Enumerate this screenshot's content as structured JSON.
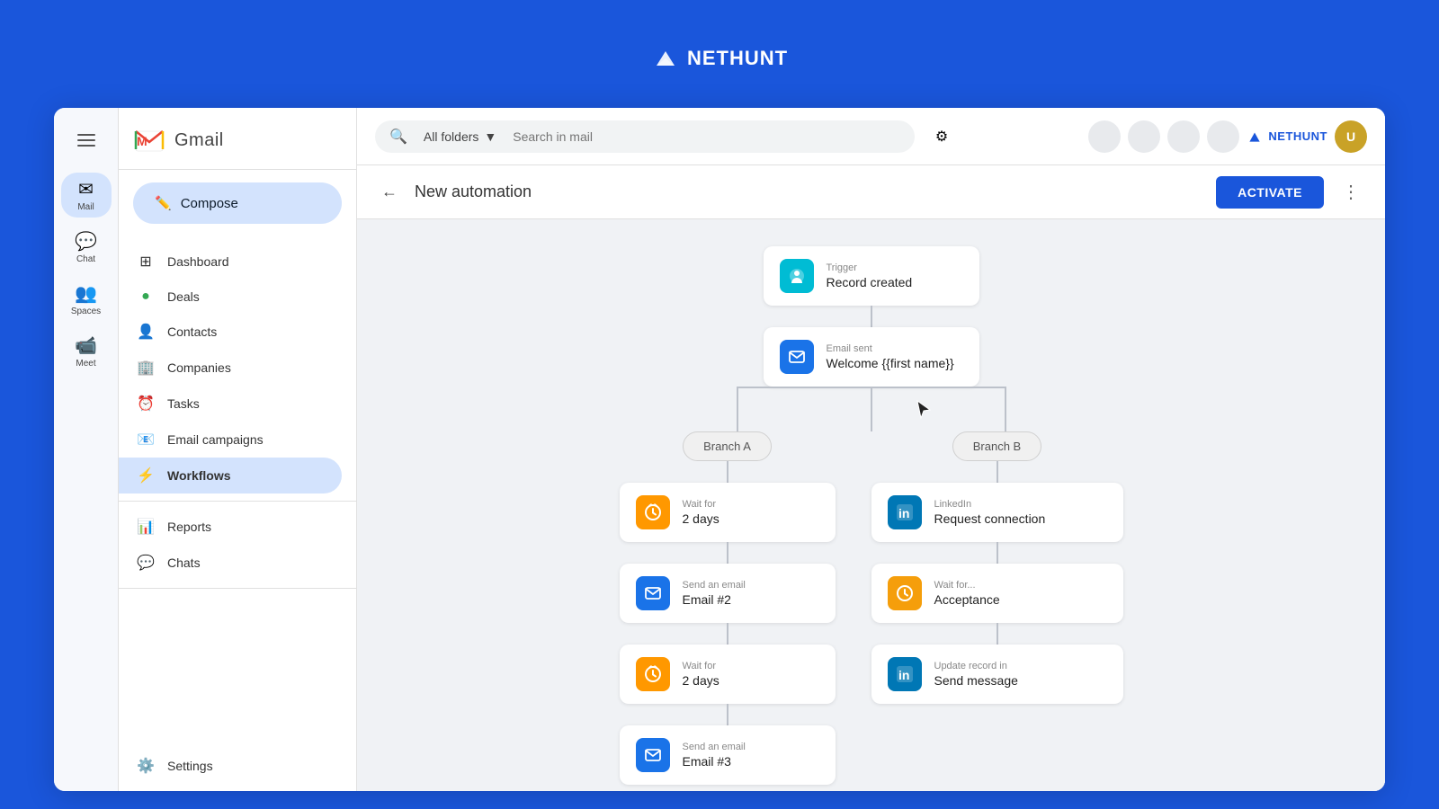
{
  "app": {
    "name": "NetHunt",
    "logo_text": "NETHUNT",
    "gmail_title": "Gmail"
  },
  "topbar": {
    "search_placeholder": "Search in mail",
    "folder_label": "All folders"
  },
  "gmail_sidebar": {
    "items": [
      {
        "id": "mail",
        "label": "Mail",
        "icon": "✉",
        "active": true
      },
      {
        "id": "chat",
        "label": "Chat",
        "icon": "💬",
        "active": false
      },
      {
        "id": "spaces",
        "label": "Spaces",
        "icon": "👥",
        "active": false
      },
      {
        "id": "meet",
        "label": "Meet",
        "icon": "📹",
        "active": false
      }
    ]
  },
  "nethunt_sidebar": {
    "compose_label": "Compose",
    "nav_items": [
      {
        "id": "dashboard",
        "label": "Dashboard",
        "icon": "⊞",
        "active": false
      },
      {
        "id": "deals",
        "label": "Deals",
        "icon": "💰",
        "active": false
      },
      {
        "id": "contacts",
        "label": "Contacts",
        "icon": "👤",
        "active": false
      },
      {
        "id": "companies",
        "label": "Companies",
        "icon": "🏢",
        "active": false
      },
      {
        "id": "tasks",
        "label": "Tasks",
        "icon": "⏰",
        "active": false
      },
      {
        "id": "email-campaigns",
        "label": "Email campaigns",
        "icon": "📧",
        "active": false
      },
      {
        "id": "workflows",
        "label": "Workflows",
        "icon": "⚡",
        "active": true
      },
      {
        "id": "reports",
        "label": "Reports",
        "icon": "📊",
        "active": false
      },
      {
        "id": "chats",
        "label": "Chats",
        "icon": "💬",
        "active": false
      }
    ],
    "settings_label": "Settings"
  },
  "automation": {
    "title": "New automation",
    "activate_label": "ACTIVATE"
  },
  "flow": {
    "trigger_node": {
      "label": "Trigger",
      "title": "Record created"
    },
    "email_sent_node": {
      "label": "Email sent",
      "title": "Welcome {{first name}}"
    },
    "branch_a_label": "Branch A",
    "branch_b_label": "Branch B",
    "branch_a": [
      {
        "label": "Wait for",
        "title": "2 days",
        "icon_type": "orange"
      },
      {
        "label": "Send an email",
        "title": "Email #2",
        "icon_type": "blue"
      },
      {
        "label": "Wait for",
        "title": "2 days",
        "icon_type": "orange"
      },
      {
        "label": "Send an email",
        "title": "Email #3",
        "icon_type": "blue"
      }
    ],
    "branch_b": [
      {
        "label": "LinkedIn",
        "title": "Request connection",
        "icon_type": "linkedin"
      },
      {
        "label": "Wait for...",
        "title": "Acceptance",
        "icon_type": "orange-warning"
      },
      {
        "label": "Update record in",
        "title": "Send message",
        "icon_type": "linkedin"
      }
    ]
  }
}
